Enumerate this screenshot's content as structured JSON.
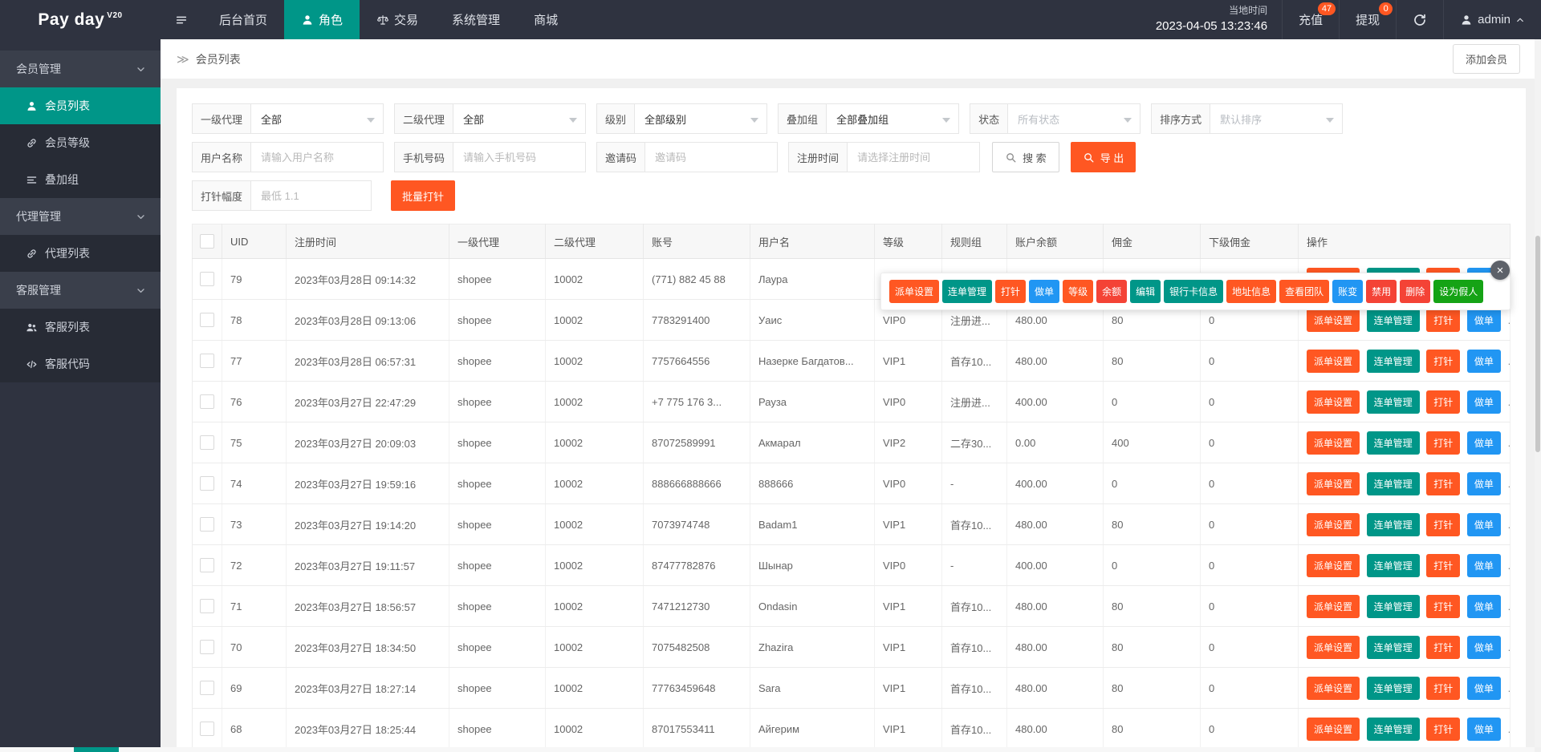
{
  "header": {
    "logo": "Pay day",
    "logo_version": "V20",
    "nav": [
      {
        "label": "后台首页",
        "icon": "",
        "active": false
      },
      {
        "label": "角色",
        "icon": "user",
        "active": true
      },
      {
        "label": "交易",
        "icon": "scales",
        "active": false
      },
      {
        "label": "系统管理",
        "icon": "",
        "active": false
      },
      {
        "label": "商城",
        "icon": "",
        "active": false
      }
    ],
    "clock_label": "当地时间",
    "clock_time": "2023-04-05 13:23:46",
    "recharge": {
      "label": "充值",
      "badge": "47"
    },
    "withdraw": {
      "label": "提现",
      "badge": "0"
    },
    "user": "admin"
  },
  "sidebar": {
    "rows": [
      {
        "label": "会员管理",
        "is_group": true
      },
      {
        "label": "会员列表",
        "icon": "user",
        "active": true
      },
      {
        "label": "会员等级",
        "icon": "link"
      },
      {
        "label": "叠加组",
        "icon": "list"
      },
      {
        "label": "代理管理",
        "is_group": true
      },
      {
        "label": "代理列表",
        "icon": "link"
      },
      {
        "label": "客服管理",
        "is_group": true
      },
      {
        "label": "客服列表",
        "icon": "users"
      },
      {
        "label": "客服代码",
        "icon": "code"
      }
    ]
  },
  "breadcrumb": {
    "arrow": "≫",
    "title": "会员列表",
    "add_button": "添加会员"
  },
  "filters": {
    "selects": [
      {
        "label": "一级代理",
        "value": "全部",
        "muted": false
      },
      {
        "label": "二级代理",
        "value": "全部",
        "muted": false
      },
      {
        "label": "级别",
        "value": "全部级别",
        "muted": false
      },
      {
        "label": "叠加组",
        "value": "全部叠加组",
        "muted": false
      },
      {
        "label": "状态",
        "value": "所有状态",
        "muted": true
      },
      {
        "label": "排序方式",
        "value": "默认排序",
        "muted": true
      }
    ],
    "inputs": [
      {
        "label": "用户名称",
        "placeholder": "请输入用户名称"
      },
      {
        "label": "手机号码",
        "placeholder": "请输入手机号码"
      },
      {
        "label": "邀请码",
        "placeholder": "邀请码"
      },
      {
        "label": "注册时间",
        "placeholder": "请选择注册时间"
      }
    ],
    "search_button": "搜 索",
    "export_button": "导 出",
    "inject_label": "打针幅度",
    "inject_placeholder": "最低 1.1",
    "batch_inject_button": "批量打针"
  },
  "table": {
    "columns": [
      "UID",
      "注册时间",
      "一级代理",
      "二级代理",
      "账号",
      "用户名",
      "等级",
      "规则组",
      "账户余额",
      "佣金",
      "下级佣金",
      "操作"
    ],
    "row_actions": [
      "派单设置",
      "连单管理",
      "打针",
      "做单"
    ],
    "row_actions_more": "...",
    "rows": [
      {
        "uid": "79",
        "reg_time": "2023年03月28日 09:14:32",
        "agent1": "shopee",
        "agent2": "10002",
        "account": "(771) 882 45 88",
        "username": "Лаура",
        "level": "",
        "rule": "",
        "balance": "",
        "commission": "",
        "sub_commission": ""
      },
      {
        "uid": "78",
        "reg_time": "2023年03月28日 09:13:06",
        "agent1": "shopee",
        "agent2": "10002",
        "account": "7783291400",
        "username": "Уаис",
        "level": "VIP0",
        "rule": "注册进...",
        "balance": "480.00",
        "commission": "80",
        "sub_commission": "0"
      },
      {
        "uid": "77",
        "reg_time": "2023年03月28日 06:57:31",
        "agent1": "shopee",
        "agent2": "10002",
        "account": "7757664556",
        "username": "Назерке Багдатов...",
        "level": "VIP1",
        "rule": "首存10...",
        "balance": "480.00",
        "commission": "80",
        "sub_commission": "0"
      },
      {
        "uid": "76",
        "reg_time": "2023年03月27日 22:47:29",
        "agent1": "shopee",
        "agent2": "10002",
        "account": "+7 775 176 3...",
        "username": "Рауза",
        "level": "VIP0",
        "rule": "注册进...",
        "balance": "400.00",
        "commission": "0",
        "sub_commission": "0"
      },
      {
        "uid": "75",
        "reg_time": "2023年03月27日 20:09:03",
        "agent1": "shopee",
        "agent2": "10002",
        "account": "87072589991",
        "username": "Акмарал",
        "level": "VIP2",
        "rule": "二存30...",
        "balance": "0.00",
        "commission": "400",
        "sub_commission": "0"
      },
      {
        "uid": "74",
        "reg_time": "2023年03月27日 19:59:16",
        "agent1": "shopee",
        "agent2": "10002",
        "account": "888666888666",
        "username": "888666",
        "level": "VIP0",
        "rule": "-",
        "balance": "400.00",
        "commission": "0",
        "sub_commission": "0"
      },
      {
        "uid": "73",
        "reg_time": "2023年03月27日 19:14:20",
        "agent1": "shopee",
        "agent2": "10002",
        "account": "7073974748",
        "username": "Badam1",
        "level": "VIP1",
        "rule": "首存10...",
        "balance": "480.00",
        "commission": "80",
        "sub_commission": "0"
      },
      {
        "uid": "72",
        "reg_time": "2023年03月27日 19:11:57",
        "agent1": "shopee",
        "agent2": "10002",
        "account": "87477782876",
        "username": "Шынар",
        "level": "VIP0",
        "rule": "-",
        "balance": "400.00",
        "commission": "0",
        "sub_commission": "0"
      },
      {
        "uid": "71",
        "reg_time": "2023年03月27日 18:56:57",
        "agent1": "shopee",
        "agent2": "10002",
        "account": "7471212730",
        "username": "Ondasin",
        "level": "VIP1",
        "rule": "首存10...",
        "balance": "480.00",
        "commission": "80",
        "sub_commission": "0"
      },
      {
        "uid": "70",
        "reg_time": "2023年03月27日 18:34:50",
        "agent1": "shopee",
        "agent2": "10002",
        "account": "7075482508",
        "username": "Zhazira",
        "level": "VIP1",
        "rule": "首存10...",
        "balance": "480.00",
        "commission": "80",
        "sub_commission": "0"
      },
      {
        "uid": "69",
        "reg_time": "2023年03月27日 18:27:14",
        "agent1": "shopee",
        "agent2": "10002",
        "account": "77763459648",
        "username": "Sara",
        "level": "VIP1",
        "rule": "首存10...",
        "balance": "480.00",
        "commission": "80",
        "sub_commission": "0"
      },
      {
        "uid": "68",
        "reg_time": "2023年03月27日 18:25:44",
        "agent1": "shopee",
        "agent2": "10002",
        "account": "87017553411",
        "username": "Айгерим",
        "level": "VIP1",
        "rule": "首存10...",
        "balance": "480.00",
        "commission": "80",
        "sub_commission": "0"
      }
    ]
  },
  "action_popup": {
    "close": "×",
    "buttons": [
      {
        "label": "派单设置",
        "color": "orange"
      },
      {
        "label": "连单管理",
        "color": "teal"
      },
      {
        "label": "打针",
        "color": "orange"
      },
      {
        "label": "做单",
        "color": "blue"
      },
      {
        "label": "等级",
        "color": "orange"
      },
      {
        "label": "余额",
        "color": "red"
      },
      {
        "label": "编辑",
        "color": "teal"
      },
      {
        "label": "银行卡信息",
        "color": "teal"
      },
      {
        "label": "地址信息",
        "color": "orange"
      },
      {
        "label": "查看团队",
        "color": "orange"
      },
      {
        "label": "账变",
        "color": "blue"
      },
      {
        "label": "禁用",
        "color": "red"
      },
      {
        "label": "删除",
        "color": "red"
      },
      {
        "label": "设为假人",
        "color": "green"
      }
    ]
  },
  "colors": {
    "accent_teal": "#009688",
    "orange": "#FF5722",
    "blue": "#2196F3",
    "red": "#F44336",
    "green": "#15A315",
    "header_dark": "#2F3340"
  }
}
